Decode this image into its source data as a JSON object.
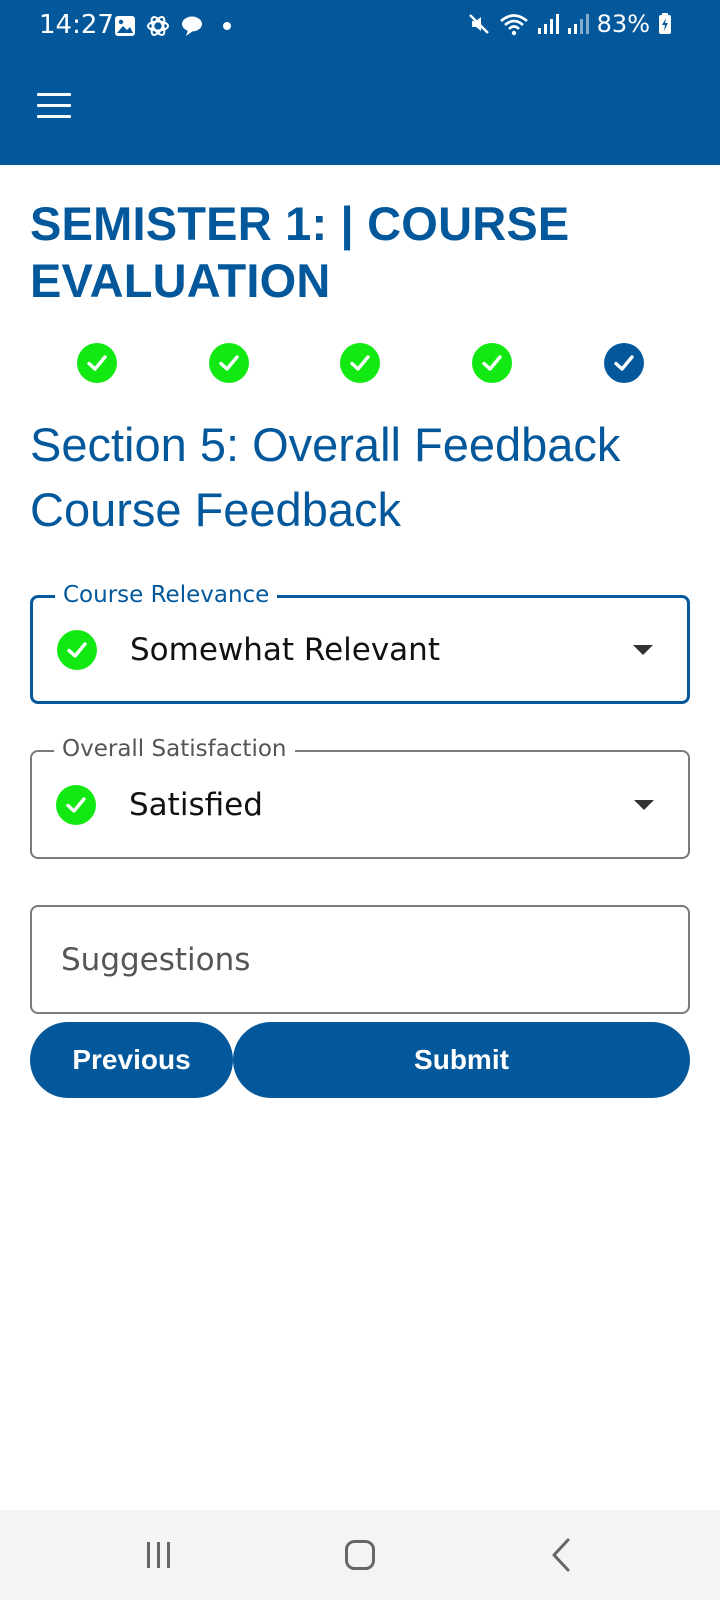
{
  "status_bar": {
    "time": "14:27",
    "battery": "83%",
    "icons": [
      "gallery-icon",
      "openai-icon",
      "chat-icon",
      "dot-icon",
      "mute-icon",
      "wifi-icon",
      "signal-icon",
      "signal-icon",
      "battery-icon"
    ]
  },
  "header": {
    "background_color": "#03589C",
    "menu_icon": "hamburger-icon"
  },
  "page": {
    "title": "SEMISTER 1: | COURSE EVALUATION",
    "section_title": "Section 5: Overall Feedback",
    "subsection_title": "Course Feedback"
  },
  "stepper": {
    "total_steps": 5,
    "completed_steps": 4,
    "current_step": 5,
    "completed_color": "#12E812",
    "current_color": "#03589C"
  },
  "fields": {
    "course_relevance": {
      "label": "Course Relevance",
      "value": "Somewhat Relevant"
    },
    "overall_satisfaction": {
      "label": "Overall Satisfaction",
      "value": "Satisfied"
    },
    "suggestions": {
      "placeholder": "Suggestions",
      "value": ""
    }
  },
  "buttons": {
    "previous": "Previous",
    "submit": "Submit"
  },
  "nav_bar": {
    "icons": [
      "recent-apps-icon",
      "home-icon",
      "back-icon"
    ]
  }
}
